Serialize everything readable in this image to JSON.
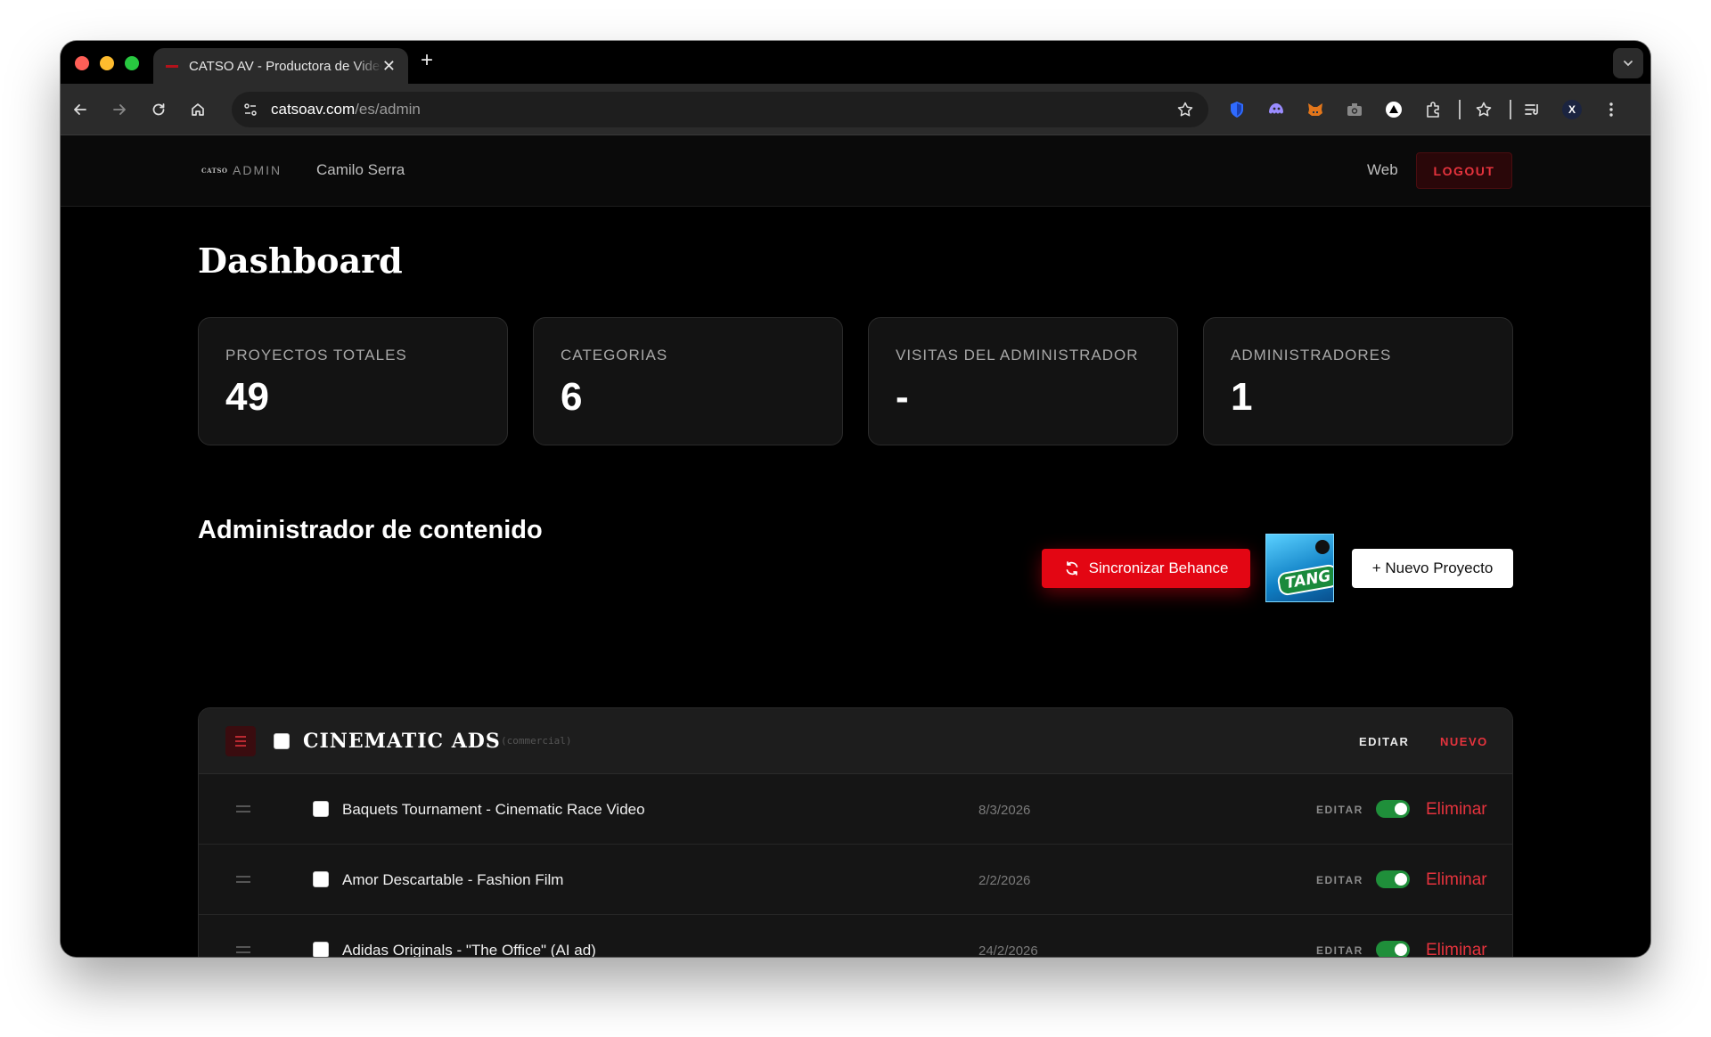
{
  "browser": {
    "tab_title": "CATSO AV - Productora de Video",
    "tab_close": "✕",
    "new_tab": "+",
    "url_host": "catsoav.com",
    "url_path": "/es/admin",
    "profile_initial": "X"
  },
  "header": {
    "brand_logo": "CATSO",
    "brand_section": "ADMIN",
    "user_name": "Camilo Serra",
    "web_link": "Web",
    "logout_label": "LOGOUT"
  },
  "dashboard": {
    "title": "Dashboard",
    "stats": [
      {
        "label": "PROYECTOS TOTALES",
        "value": "49"
      },
      {
        "label": "CATEGORIAS",
        "value": "6"
      },
      {
        "label": "VISITAS DEL ADMINISTRADOR",
        "value": "-"
      },
      {
        "label": "ADMINISTRADORES",
        "value": "1"
      }
    ]
  },
  "content": {
    "title": "Administrador de contenido",
    "sync_label": "Sincronizar Behance",
    "thumbnail_text": "TANG",
    "new_project_label": "+ Nuevo Proyecto"
  },
  "category": {
    "name": "CINEMATIC ADS",
    "slug": "(commercial)",
    "edit_label": "EDITAR",
    "new_label": "NUEVO",
    "projects": [
      {
        "title": "Baquets Tournament - Cinematic Race Video",
        "date": "8/3/2026",
        "edit": "EDITAR",
        "delete": "Eliminar",
        "published": true
      },
      {
        "title": "Amor Descartable - Fashion Film",
        "date": "2/2/2026",
        "edit": "EDITAR",
        "delete": "Eliminar",
        "published": true
      },
      {
        "title": "Adidas Originals - \"The Office\" (AI ad)",
        "date": "24/2/2026",
        "edit": "EDITAR",
        "delete": "Eliminar",
        "published": true
      }
    ]
  },
  "colors": {
    "accent_red": "#e30613",
    "toggle_green": "#1f8f3a",
    "background": "#000000"
  },
  "icons": [
    "back-arrow-icon",
    "forward-arrow-icon",
    "reload-icon",
    "home-icon",
    "site-settings-icon",
    "bookmark-star-icon",
    "extension-puzzle-icon",
    "reading-list-icon",
    "kebab-menu-icon",
    "sync-icon",
    "hamburger-menu-icon",
    "drag-handle-icon"
  ]
}
